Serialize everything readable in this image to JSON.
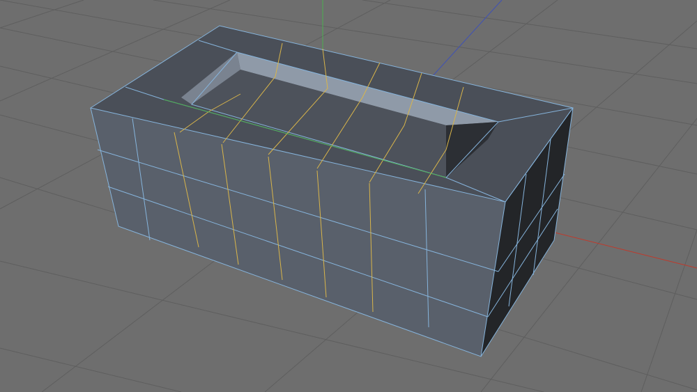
{
  "viewport": {
    "view_type": "perspective-3d",
    "background_color": "#6e6e6e",
    "grid_color": "#5d5d5d",
    "axis_colors": {
      "x": "#c0392b",
      "y": "#4caf50",
      "z": "#3f51b5"
    }
  },
  "object": {
    "type": "polygon-mesh",
    "shape": "box with recessed slot on top",
    "top_face_color": "#4a4f58",
    "side_face_color": "#59606b",
    "end_face_color": "#232528",
    "slot_wall_color": "#8f9aa8",
    "edge_color": "#86b4dc",
    "selected_edge_color": "#d9b54a",
    "selected_loops": 6
  }
}
